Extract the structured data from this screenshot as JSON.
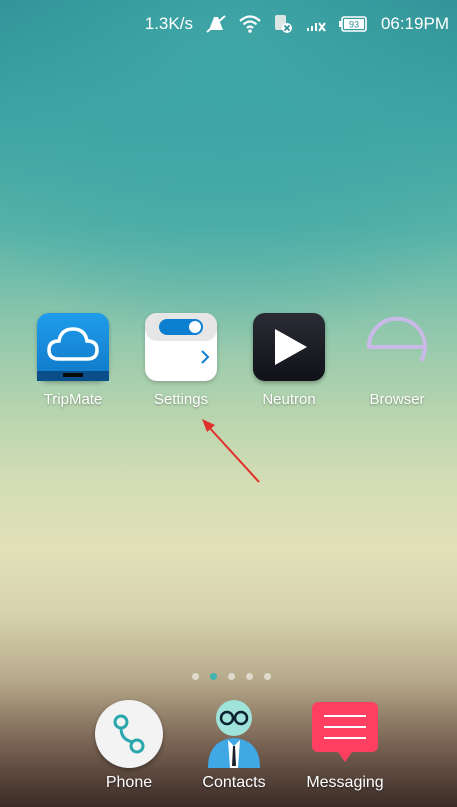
{
  "status_bar": {
    "network_speed": "1.3K/s",
    "battery_level": "93",
    "time": "06:19PM",
    "icons": [
      "notifications-muted-icon",
      "wifi-icon",
      "sim-error-icon",
      "signal-icon",
      "battery-icon"
    ]
  },
  "home": {
    "apps": [
      {
        "label": "TripMate",
        "icon": "cloud-icon"
      },
      {
        "label": "Settings",
        "icon": "toggle-card-icon"
      },
      {
        "label": "Neutron",
        "icon": "play-icon"
      },
      {
        "label": "Browser",
        "icon": "e-browser-icon"
      }
    ],
    "page_indicator": {
      "count": 5,
      "active": 2
    }
  },
  "dock": {
    "items": [
      {
        "label": "Phone",
        "icon": "phone-handset-icon"
      },
      {
        "label": "Contacts",
        "icon": "contact-person-icon"
      },
      {
        "label": "Messaging",
        "icon": "message-bubble-icon"
      }
    ]
  },
  "annotation": {
    "color": "#e0302c",
    "target": "Settings"
  }
}
